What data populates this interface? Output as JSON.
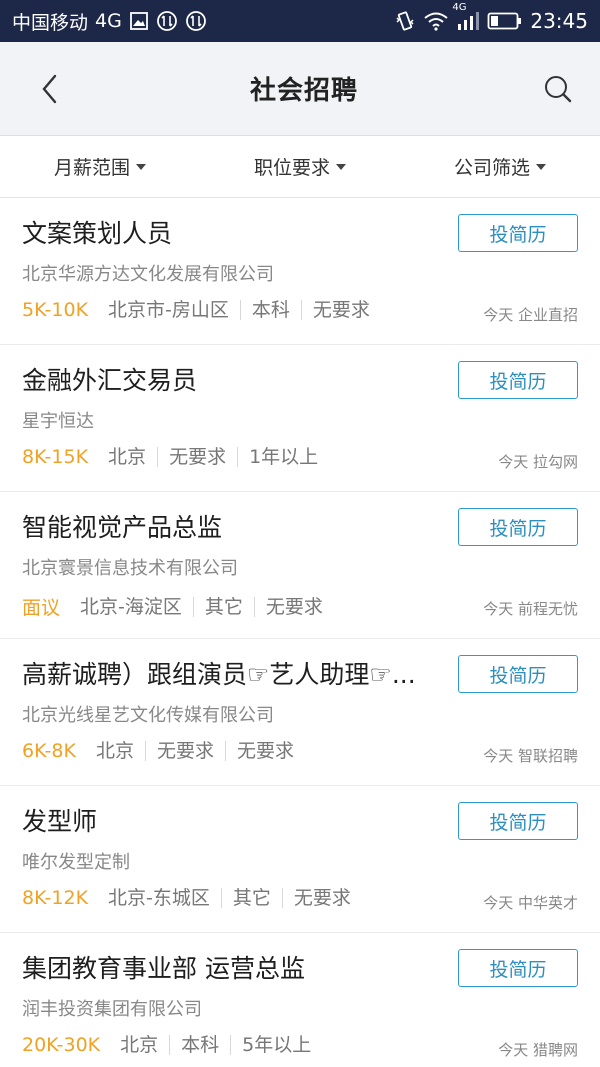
{
  "status_bar": {
    "carrier": "中国移动",
    "network": "4G",
    "signal_label": "4G",
    "time": "23:45",
    "icons": [
      "image-icon",
      "sync-icon",
      "sync-icon",
      "vibrate-icon",
      "wifi-icon",
      "signal-icon",
      "battery-icon"
    ]
  },
  "header": {
    "title": "社会招聘",
    "back_icon": "chevron-left-icon",
    "search_icon": "search-icon"
  },
  "filters": [
    {
      "label": "月薪范围"
    },
    {
      "label": "职位要求"
    },
    {
      "label": "公司筛选"
    }
  ],
  "jobs": [
    {
      "title": "文案策划人员",
      "company": "北京华源方达文化发展有限公司",
      "salary": "5K-10K",
      "tags": [
        "北京市-房山区",
        "本科",
        "无要求"
      ],
      "date": "今天",
      "source": "企业直招",
      "apply_label": "投简历"
    },
    {
      "title": "金融外汇交易员",
      "company": "星宇恒达",
      "salary": "8K-15K",
      "tags": [
        "北京",
        "无要求",
        "1年以上"
      ],
      "date": "今天",
      "source": "拉勾网",
      "apply_label": "投简历"
    },
    {
      "title": "智能视觉产品总监",
      "company": "北京寰景信息技术有限公司",
      "salary": "面议",
      "tags": [
        "北京-海淀区",
        "其它",
        "无要求"
      ],
      "date": "今天",
      "source": "前程无忧",
      "apply_label": "投简历"
    },
    {
      "title": "高薪诚聘）跟组演员☞艺人助理☞...",
      "company": "北京光线星艺文化传媒有限公司",
      "salary": "6K-8K",
      "tags": [
        "北京",
        "无要求",
        "无要求"
      ],
      "date": "今天",
      "source": "智联招聘",
      "apply_label": "投简历"
    },
    {
      "title": "发型师",
      "company": "唯尔发型定制",
      "salary": "8K-12K",
      "tags": [
        "北京-东城区",
        "其它",
        "无要求"
      ],
      "date": "今天",
      "source": "中华英才",
      "apply_label": "投简历"
    },
    {
      "title": "集团教育事业部 运营总监",
      "company": "润丰投资集团有限公司",
      "salary": "20K-30K",
      "tags": [
        "北京",
        "本科",
        "5年以上"
      ],
      "date": "今天",
      "source": "猎聘网",
      "apply_label": "投简历"
    }
  ],
  "colors": {
    "status_bar_bg": "#1d2748",
    "header_bg": "#f1f3f6",
    "salary": "#f0a225",
    "accent": "#2c9bc9"
  }
}
